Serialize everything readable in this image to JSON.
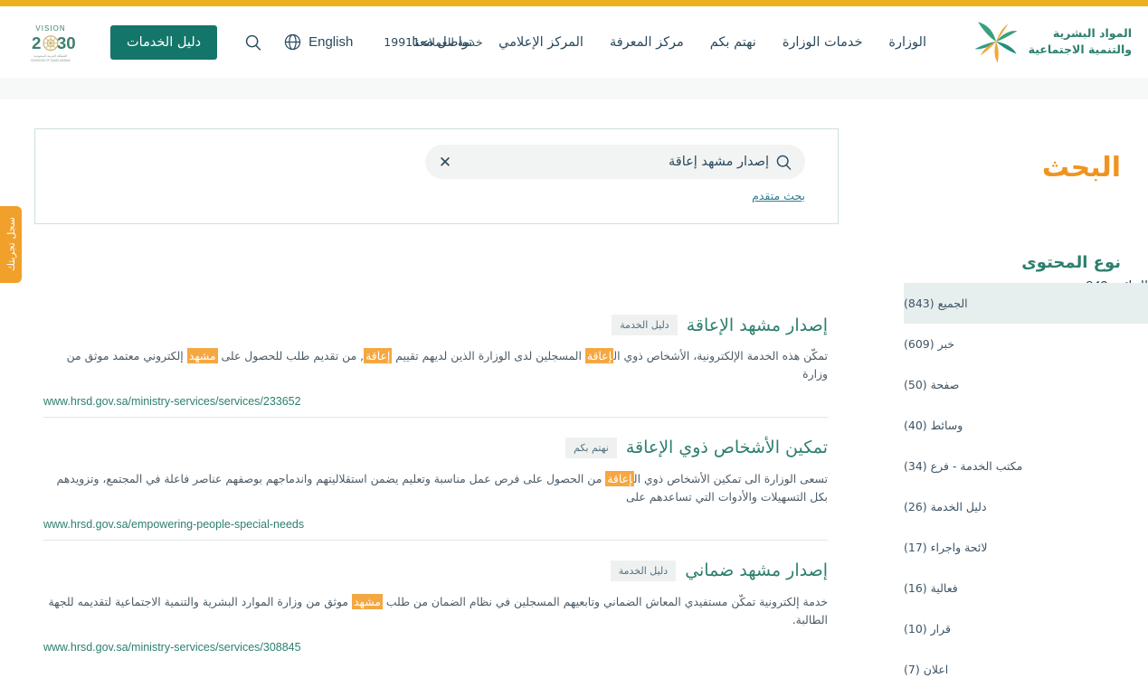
{
  "colors": {
    "top_accent": "#edb11f",
    "brand_teal": "#2c7f6e",
    "button_teal": "#14766a",
    "title_orange": "#ef9421",
    "highlight_orange": "#f5a742",
    "side_tab_orange": "#f0a02b",
    "nav_text": "#29495e",
    "active_filter_bg": "#e7eeee"
  },
  "header": {
    "logo": {
      "name": "ministry-logo",
      "text": "المواد البشرية\nوالتنمية الاجتماعية"
    },
    "nav": [
      {
        "label": "الوزارة",
        "name": "nav-ministry"
      },
      {
        "label": "خدمات الوزارة",
        "name": "nav-ministry-services"
      },
      {
        "label": "نهتم بكم",
        "name": "nav-we-care"
      },
      {
        "label": "مركز المعرفة",
        "name": "nav-knowledge-center"
      },
      {
        "label": "المركز الإعلامي",
        "name": "nav-media-center"
      },
      {
        "label": "تواصل معنا",
        "name": "nav-contact-us"
      }
    ],
    "customer_service": "خدمة العملاء 19911",
    "language_label": "English",
    "language_icon": "globe-icon",
    "search_icon": "search-icon",
    "services_button": "دليل الخدمات",
    "vision_logo": {
      "name": "vision-2030-logo",
      "title": "VISION",
      "number": "2030",
      "subtitle_ar": "المملكة العربية السعودية",
      "subtitle_en": "KINGDOM OF SAUDI ARABIA"
    }
  },
  "side_tab": {
    "label": "سجل تجربتك",
    "name": "record-your-experience-tab"
  },
  "page": {
    "title": "البحث"
  },
  "search": {
    "value": "إصدار مشهد إعاقة",
    "placeholder": "إصدار مشهد إعاقة",
    "clear_icon": "✕",
    "magnifier_icon": "search-icon",
    "advanced_link": "بحث متقدم"
  },
  "results": {
    "count_label": "النتائج:",
    "count": "843",
    "items": [
      {
        "title": "إصدار مشهد الإعاقة",
        "badge": "دليل الخدمة",
        "desc_parts": [
          {
            "t": "تمكّن هذه الخدمة الإلكترونية، الأشخاص ذوي ال",
            "h": false
          },
          {
            "t": "إعاقة",
            "h": true
          },
          {
            "t": " المسجلين لدى الوزارة الذين لديهم تقييم ",
            "h": false
          },
          {
            "t": "إعاقة",
            "h": true
          },
          {
            "t": ", من تقديم طلب للحصول على ",
            "h": false
          },
          {
            "t": "مشهد",
            "h": true
          },
          {
            "t": " إلكتروني معتمد موثق من وزارة",
            "h": false
          }
        ],
        "url": "www.hrsd.gov.sa/ministry-services/services/233652"
      },
      {
        "title": "تمكين الأشخاص ذوي الإعاقة",
        "badge": "نهتم بكم",
        "desc_parts": [
          {
            "t": "تسعى الوزارة الى تمكين الأشخاص ذوي ال",
            "h": false
          },
          {
            "t": "إعاقة",
            "h": true
          },
          {
            "t": " من الحصول على فرص عمل مناسبة وتعليم يضمن استقلاليتهم واندماجهم بوصفهم عناصر فاعلة في المجتمع، وتزويدهم بكل التسهيلات والأدوات التي تساعدهم على",
            "h": false
          }
        ],
        "url": "www.hrsd.gov.sa/empowering-people-special-needs"
      },
      {
        "title": "إصدار مشهد ضماني",
        "badge": "دليل الخدمة",
        "desc_parts": [
          {
            "t": "خدمة إلكترونية تمكّن مستفيدي المعاش الضماني وتابعيهم المسجلين في نظام الضمان من طلب ",
            "h": false
          },
          {
            "t": "مشهد",
            "h": true
          },
          {
            "t": " موثق من وزارة الموارد البشرية والتنمية الاجتماعية لتقديمه للجهة الطالبة.",
            "h": false
          }
        ],
        "url": "www.hrsd.gov.sa/ministry-services/services/308845"
      }
    ]
  },
  "filters": {
    "title": "نوع المحتوى",
    "items": [
      {
        "label": "الجميع (843)",
        "active": true,
        "name": "filter-all"
      },
      {
        "label": "خبر (609)",
        "active": false,
        "name": "filter-news"
      },
      {
        "label": "صفحة (50)",
        "active": false,
        "name": "filter-page"
      },
      {
        "label": "وسائط (40)",
        "active": false,
        "name": "filter-media"
      },
      {
        "label": "مكتب الخدمة - فرع (34)",
        "active": false,
        "name": "filter-service-office-branch"
      },
      {
        "label": "دليل الخدمة (26)",
        "active": false,
        "name": "filter-service-guide"
      },
      {
        "label": "لائحة واجراء (17)",
        "active": false,
        "name": "filter-regulation-procedure"
      },
      {
        "label": "فعالية (16)",
        "active": false,
        "name": "filter-event"
      },
      {
        "label": "قرار (10)",
        "active": false,
        "name": "filter-decision"
      },
      {
        "label": "اعلان (7)",
        "active": false,
        "name": "filter-announcement"
      }
    ]
  }
}
